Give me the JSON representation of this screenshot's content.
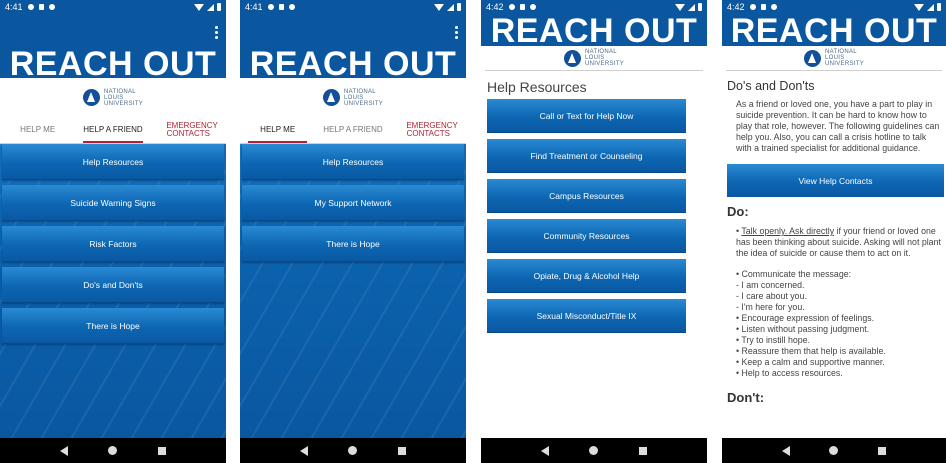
{
  "brand": {
    "title": "REACH OUT",
    "logo_line1": "NATIONAL",
    "logo_line2": "LOUIS",
    "logo_line3": "UNIVERSITY"
  },
  "colors": {
    "primary": "#0a57a0",
    "accent_red": "#b22234"
  },
  "tabs": [
    "HELP ME",
    "HELP A FRIEND",
    "EMERGENCY CONTACTS"
  ],
  "screens": [
    {
      "time": "4:41",
      "active_tab": 1,
      "items": [
        "Help Resources",
        "Suicide Warning Signs",
        "Risk Factors",
        "Do's and Don'ts",
        "There is Hope"
      ]
    },
    {
      "time": "4:41",
      "active_tab": 0,
      "items": [
        "Help Resources",
        "My Support Network",
        "There is Hope"
      ]
    },
    {
      "time": "4:42",
      "heading": "Help Resources",
      "items": [
        "Call or Text for Help Now",
        "Find Treatment or Counseling",
        "Campus Resources",
        "Community Resources",
        "Opiate, Drug & Alcohol Help",
        "Sexual Misconduct/Title IX"
      ]
    },
    {
      "time": "4:42",
      "title": "Do's and Don'ts",
      "intro": "As a friend or loved one, you have a part to play in suicide prevention. It can be hard to know how to play that role, however. The following guidelines can help you. Also, you can call a crisis hotline to talk with a trained specialist for additional guidance.",
      "button": "View Help Contacts",
      "do_heading": "Do:",
      "do_first_underlined": "Talk openly. Ask directly",
      "do_first_rest": " if your friend or loved one has been thinking about suicide. Asking will not plant the idea of suicide or cause them to act on it.",
      "do_list": [
        "• Communicate the message:",
        "- I am concerned.",
        "- I care about you.",
        "- I'm here for you.",
        "• Encourage expression of feelings.",
        "• Listen without passing judgment.",
        "• Try to instill hope.",
        "• Reassure them that help is available.",
        "• Keep a calm and supportive manner.",
        "• Help to access resources."
      ],
      "dont_heading": "Don't:"
    }
  ]
}
